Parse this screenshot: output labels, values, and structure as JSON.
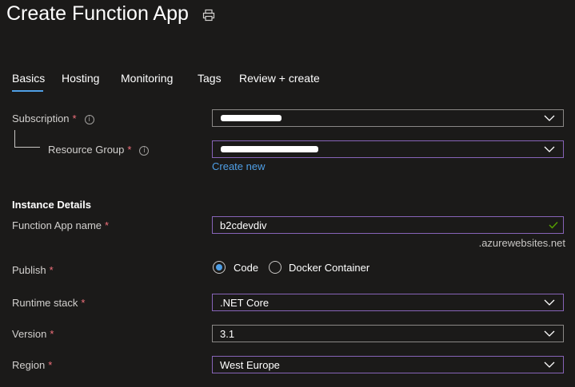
{
  "header": {
    "title": "Create Function App",
    "print_icon": "print-icon"
  },
  "tabs": [
    {
      "label": "Basics",
      "active": true
    },
    {
      "label": "Hosting"
    },
    {
      "label": "Monitoring"
    },
    {
      "label": "Tags"
    },
    {
      "label": "Review + create"
    }
  ],
  "project": {
    "subscription_label": "Subscription",
    "resource_group_label": "Resource Group",
    "create_new_link": "Create new"
  },
  "instance": {
    "section_title": "Instance Details",
    "name_label": "Function App name",
    "name_value": "b2cdevdiv",
    "name_suffix": ".azurewebsites.net",
    "publish_label": "Publish",
    "publish_options": [
      "Code",
      "Docker Container"
    ],
    "publish_selected": "Code",
    "runtime_label": "Runtime stack",
    "runtime_value": ".NET Core",
    "version_label": "Version",
    "version_value": "3.1",
    "region_label": "Region",
    "region_value": "West Europe"
  },
  "required_marker": "*",
  "colors": {
    "accent": "#4f9fe6",
    "required": "#f1707b",
    "valid": "#57a300",
    "focus_border": "#8764b8",
    "background": "#1b1a19"
  }
}
